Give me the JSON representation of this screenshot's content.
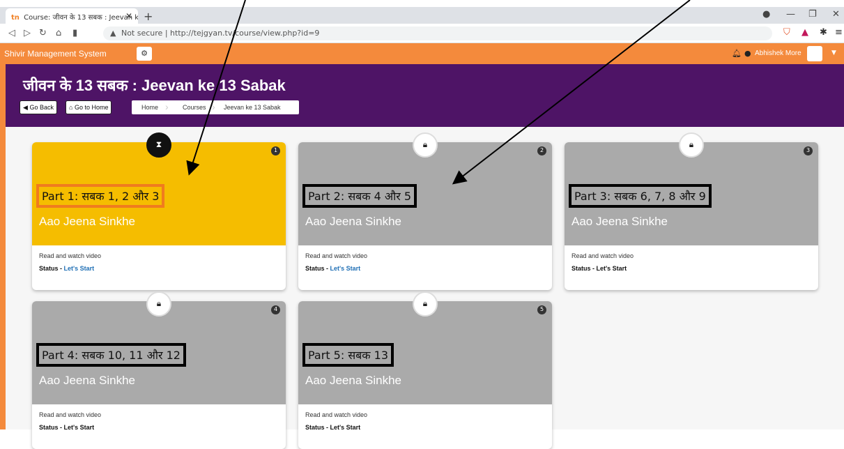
{
  "browser": {
    "tab_title": "Course: जीवन के 13 सबक : Jeevan k",
    "tab_icon": "tn",
    "url_warning": "Not secure",
    "url": "http://tejgyan.tv/course/view.php?id=9"
  },
  "app": {
    "brand": "Shivir Management System",
    "user_name": "Abhishek More",
    "accent": "#f48a3c",
    "banner_color": "#4e1466"
  },
  "banner": {
    "title": "जीवन के 13 सबक : Jeevan ke 13 Sabak",
    "go_back": "Go Back",
    "go_home": "Go to Home",
    "breadcrumb": [
      "Home",
      "Courses",
      "Jeevan ke 13 Sabak"
    ]
  },
  "cards": [
    {
      "number": "1",
      "part": "Part 1: सबक 1, 2 और 3",
      "subtitle": "Aao Jeena Sinkhe",
      "desc": "Read and watch video",
      "status_label": "Status - ",
      "status_value": "Let's Start",
      "state": "active"
    },
    {
      "number": "2",
      "part": "Part 2: सबक 4 और 5",
      "subtitle": "Aao Jeena Sinkhe",
      "desc": "Read and watch video",
      "status_label": "Status - ",
      "status_value": "Let's Start",
      "state": "locked"
    },
    {
      "number": "3",
      "part": "Part 3: सबक 6, 7, 8 और 9",
      "subtitle": "Aao Jeena Sinkhe",
      "desc": "Read and watch video",
      "status_label": "Status - ",
      "status_value": "Let's Start",
      "state": "locked"
    },
    {
      "number": "4",
      "part": "Part 4: सबक 10, 11 और 12",
      "subtitle": "Aao Jeena Sinkhe",
      "desc": "Read and watch video",
      "status_label": "Status - ",
      "status_value": "Let's Start",
      "state": "locked"
    },
    {
      "number": "5",
      "part": "Part 5: सबक 13",
      "subtitle": "Aao Jeena Sinkhe",
      "desc": "Read and watch video",
      "status_label": "Status - ",
      "status_value": "Let's Start",
      "state": "locked"
    }
  ]
}
